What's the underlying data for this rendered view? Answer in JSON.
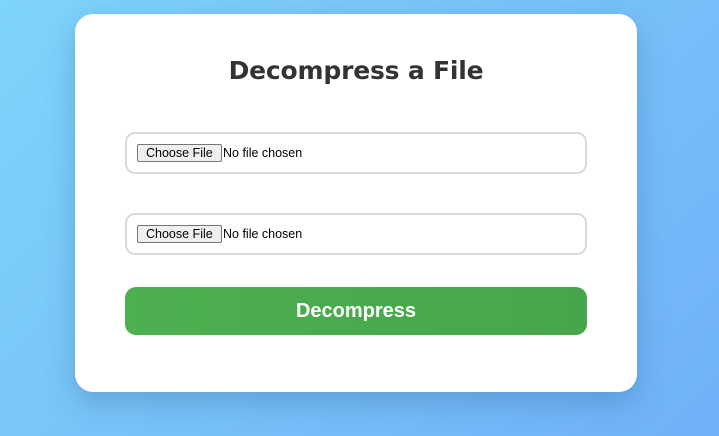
{
  "page": {
    "title": "Decompress a File"
  },
  "file_inputs": [
    {
      "button_label": "Choose File",
      "status": "No file chosen"
    },
    {
      "button_label": "Choose File",
      "status": "No file chosen"
    }
  ],
  "actions": {
    "decompress_label": "Decompress"
  },
  "colors": {
    "background_gradient_start": "#7fd4fb",
    "background_gradient_end": "#6fb1f7",
    "card": "#ffffff",
    "title_text": "#333333",
    "accent_green": "#4caf50",
    "input_border": "#d9d9d9"
  }
}
